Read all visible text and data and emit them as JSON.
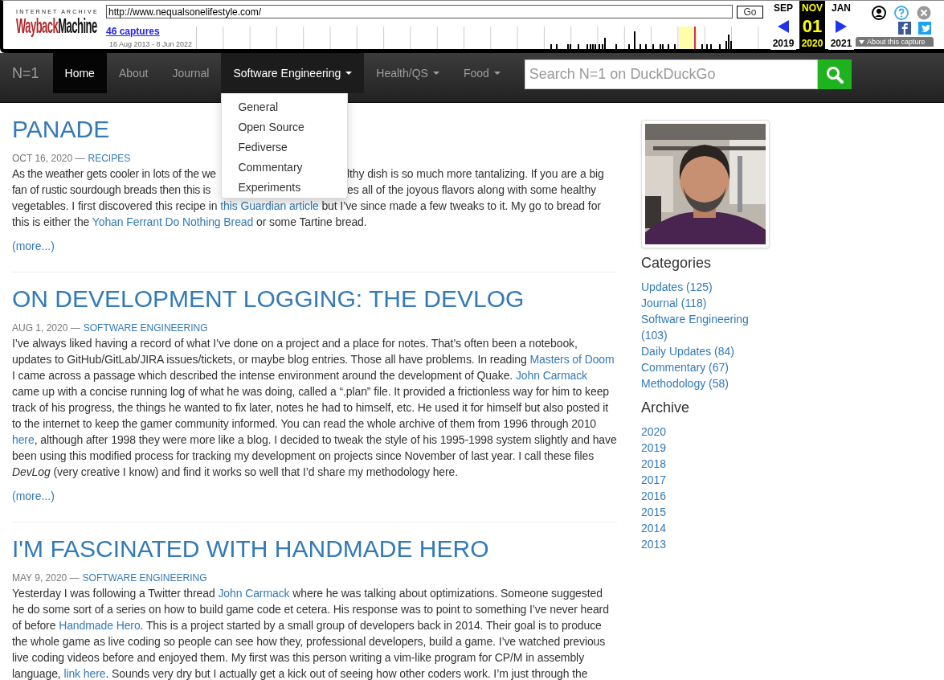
{
  "wayback": {
    "logo_top": "INTERNET ARCHIVE",
    "logo_red": "Wayback",
    "logo_black": "Machine",
    "url": "http://www.nequalsonelifestyle.com/",
    "go": "Go",
    "captures": "46 captures",
    "range": "16 Aug 2013 - 8 Jun 2022",
    "calendar": [
      {
        "month": "SEP",
        "year": "2019",
        "selected": false
      },
      {
        "month": "NOV",
        "day": "01",
        "year": "2020",
        "selected": true
      },
      {
        "month": "JAN",
        "year": "2021",
        "selected": false
      }
    ],
    "about": "About this capture"
  },
  "navbar": {
    "brand": "N=1",
    "items": [
      {
        "label": "Home",
        "selected": true,
        "has_menu": false,
        "expanded": false
      },
      {
        "label": "About",
        "selected": false,
        "has_menu": false,
        "expanded": false
      },
      {
        "label": "Journal",
        "selected": false,
        "has_menu": false,
        "expanded": false
      },
      {
        "label": "Software Engineering",
        "selected": false,
        "has_menu": true,
        "expanded": true,
        "menu": [
          "General",
          "Open Source",
          "Fediverse",
          "Commentary",
          "Experiments"
        ]
      },
      {
        "label": "Health/QS",
        "selected": false,
        "has_menu": true,
        "expanded": false
      },
      {
        "label": "Food",
        "selected": false,
        "has_menu": true,
        "expanded": false
      }
    ],
    "search": {
      "placeholder": "Search N=1 on DuckDuckGo"
    }
  },
  "posts": [
    {
      "kind": "covered",
      "title": "PANADE",
      "date": "OCT 16, 2020 —",
      "category": "RECIPES",
      "lines": [
        [
          [
            {
              "kind": "text",
              "text": "As the weather gets cooler in lots of the we"
            }
          ],
          [
            {
              "kind": "text",
              "text": "lthy dish is so much more tantalizing. If you are a big"
            }
          ]
        ],
        [
          [
            {
              "kind": "text",
              "text": "fan of rustic sourdough breads then this is"
            }
          ],
          [
            {
              "kind": "text",
              "text": "es all of the joyous flavors along with some healthy"
            }
          ]
        ],
        [
          [
            {
              "kind": "text",
              "text": "vegetables. I first discovered this recipe in "
            },
            {
              "kind": "link",
              "text": "this Guardian article"
            },
            {
              "kind": "text",
              "text": " but I’ve since made a few tweaks to it. My go to bread for"
            }
          ]
        ],
        [
          [
            {
              "kind": "text",
              "text": "this is either the "
            },
            {
              "kind": "link",
              "text": "Yohan Ferrant Do Nothing Bread"
            },
            {
              "kind": "text",
              "text": " or some Tartine bread."
            }
          ]
        ]
      ],
      "more": "(more...)"
    },
    {
      "kind": "flow",
      "title": "ON DEVELOPMENT LOGGING: THE DEVLOG",
      "date": "AUG 1, 2020 —",
      "category": "SOFTWARE ENGINEERING",
      "body": [
        {
          "kind": "text",
          "text": "I’ve always liked having a record of what I’ve done on a project and a place for notes. That’s often been a notebook, updates to GitHub/GitLab/JIRA issues/tickets, or maybe blog entries. Those all have problems. In reading "
        },
        {
          "kind": "link",
          "text": "Masters of Doom"
        },
        {
          "kind": "text",
          "text": " I came across a passage which described the intense environment around the development of Quake. "
        },
        {
          "kind": "link",
          "text": "John Carmack"
        },
        {
          "kind": "text",
          "text": " came up with a concise running log of what he was doing, called a “.plan” file. It provided a frictionless way for him to keep track of his progress, the things he wanted to fix later, notes he had to himself, etc. He used it for himself but also posted it to the internet to keep the gamer community informed. You can read the whole archive of them from 1996 through 2010 "
        },
        {
          "kind": "link",
          "text": "here"
        },
        {
          "kind": "text",
          "text": ", although after 1998 they were more like a blog. I decided to tweak the style of his 1995-1998 system slightly and have been using this modified process for tracking my development on projects since November of last year. I call these files *DevLog* (very creative I know) and find it works so well that I’d share my methodology here."
        }
      ],
      "more": "(more...)"
    },
    {
      "kind": "flow",
      "title": "I'M FASCINATED WITH HANDMADE HERO",
      "date": "MAY 9, 2020 —",
      "category": "SOFTWARE ENGINEERING",
      "body": [
        {
          "kind": "text",
          "text": "Yesterday I was following a Twitter thread "
        },
        {
          "kind": "link",
          "text": "John Carmack"
        },
        {
          "kind": "text",
          "text": " where he was talking about optimizations. Someone suggested he do some sort of a series on how to build game code et cetera. His response was to point to something I’ve never heard of before "
        },
        {
          "kind": "link",
          "text": "Handmade Hero"
        },
        {
          "kind": "text",
          "text": ". This is a project started by a small group of developers back in 2014. Their goal is to produce the whole game as live coding so people can see how they, professional developers, build a game. I’ve watched previous live coding videos before and enjoyed them. My first was this person writing a vim-like program for CP/M in assembly language, "
        },
        {
          "kind": "link",
          "text": "link here"
        },
        {
          "kind": "text",
          "text": ". Sounds very dry but I actually get a kick out of seeing how other coders work. I’m just through the"
        }
      ]
    }
  ],
  "sidebar": {
    "categories_title": "Categories",
    "categories": [
      "Updates (125)",
      "Journal (118)",
      "Software Engineering (103)",
      "Daily Updates (84)",
      "Commentary (67)",
      "Methodology (58)"
    ],
    "archive_title": "Archive",
    "archive": [
      "2020",
      "2019",
      "2018",
      "2017",
      "2016",
      "2015",
      "2014",
      "2013"
    ]
  }
}
